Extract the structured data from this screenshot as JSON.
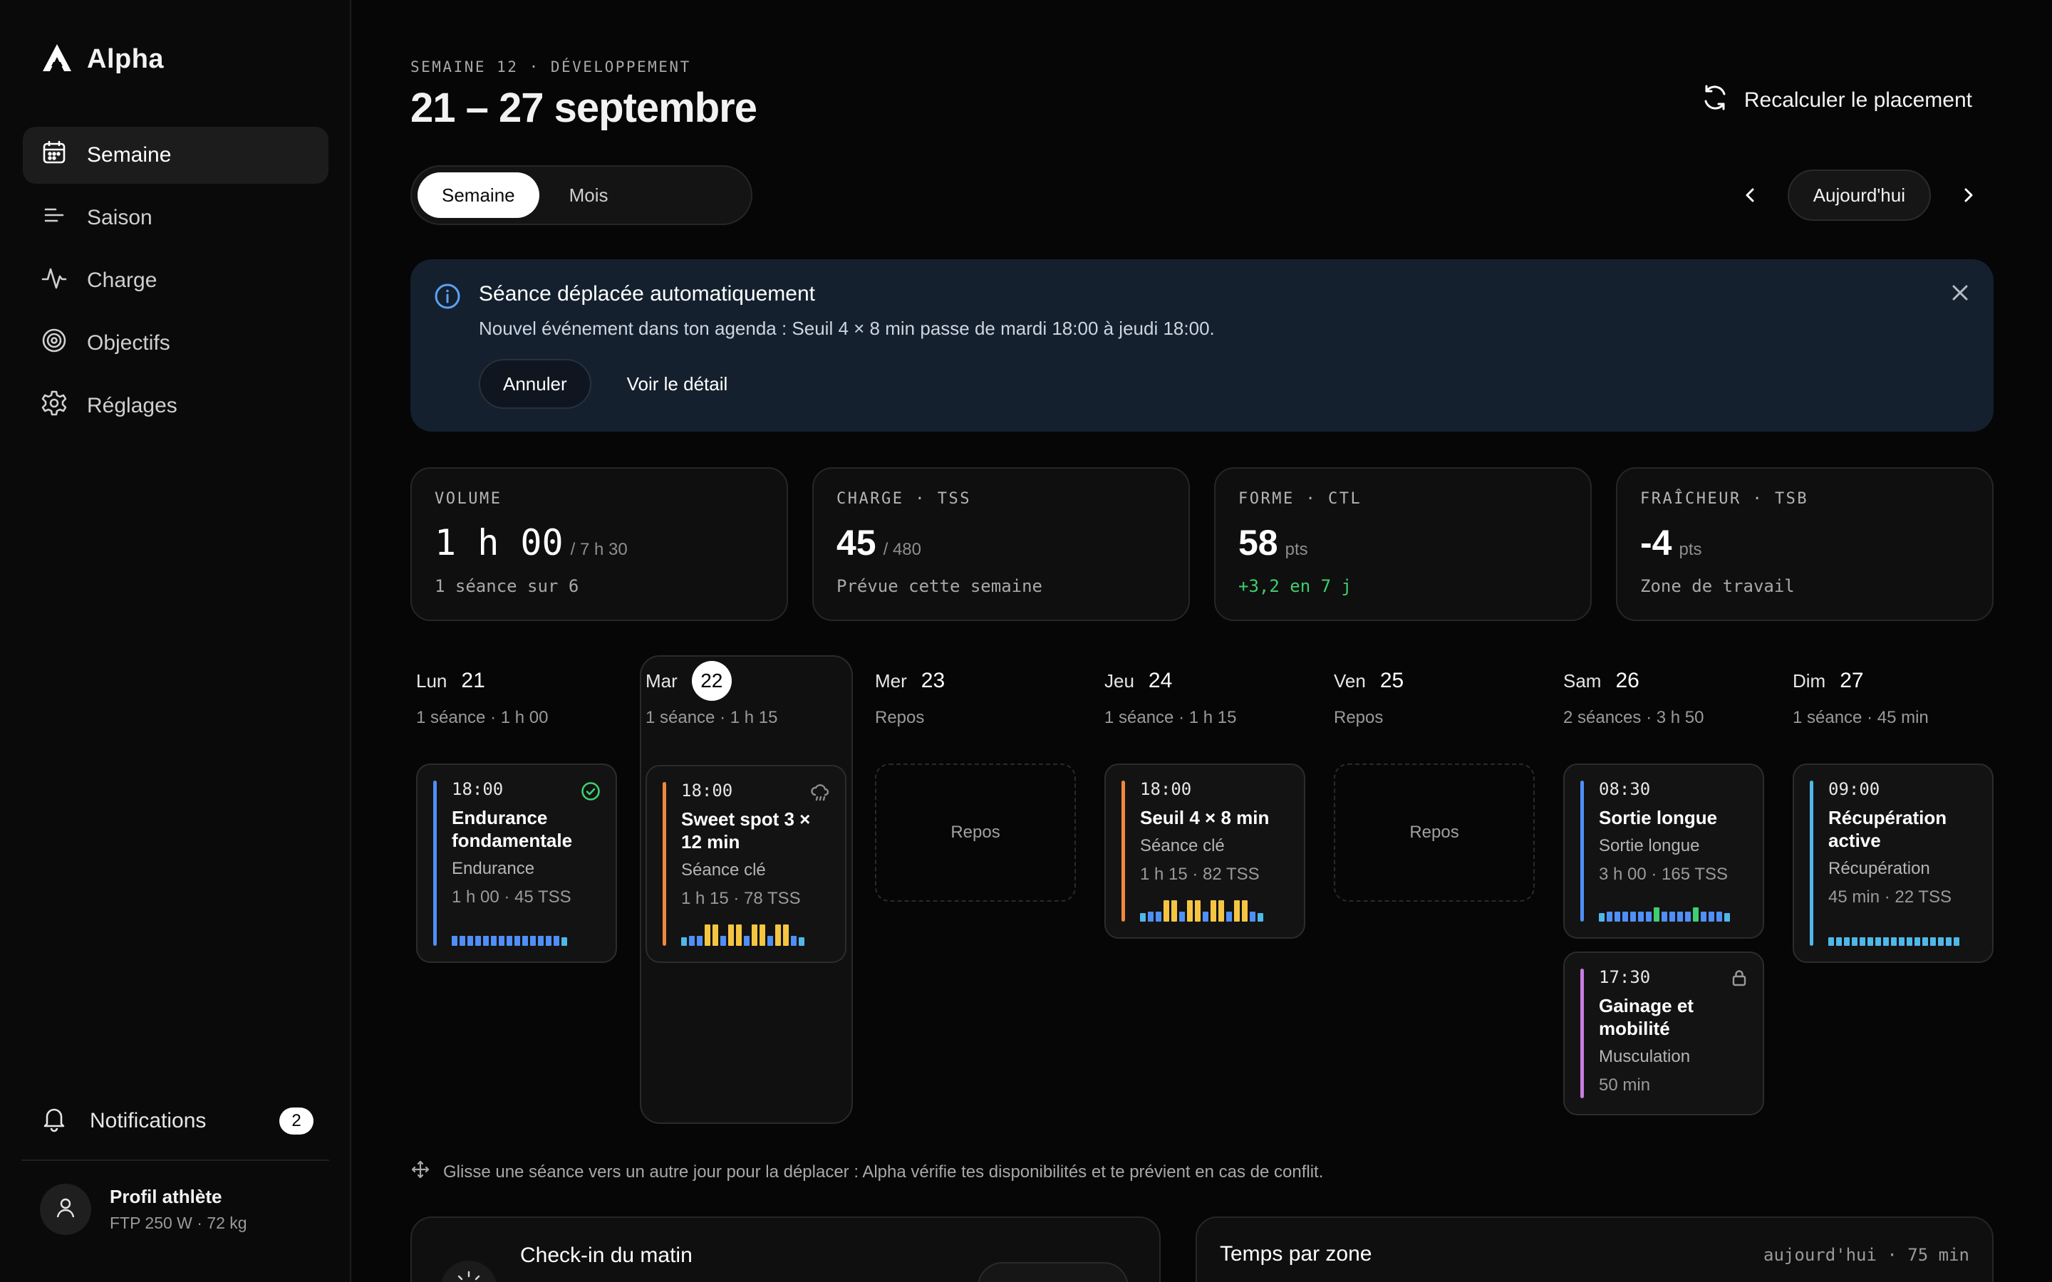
{
  "app": {
    "name": "Alpha"
  },
  "sidebar": {
    "items": [
      {
        "label": "Semaine",
        "icon": "calendar-icon",
        "active": true
      },
      {
        "label": "Saison",
        "icon": "list-icon",
        "active": false
      },
      {
        "label": "Charge",
        "icon": "pulse-icon",
        "active": false
      },
      {
        "label": "Objectifs",
        "icon": "target-icon",
        "active": false
      },
      {
        "label": "Réglages",
        "icon": "gear-icon",
        "active": false
      }
    ],
    "notifications": {
      "label": "Notifications",
      "count": "2"
    },
    "profile": {
      "name": "Profil athlète",
      "details": "FTP 250 W · 72 kg"
    }
  },
  "header": {
    "eyebrow": "SEMAINE 12 · DÉVELOPPEMENT",
    "title": "21 – 27 septembre",
    "recalc_label": "Recalculer le placement",
    "view_toggle": {
      "week": "Semaine",
      "month": "Mois",
      "selected": "Semaine"
    },
    "today_label": "Aujourd'hui"
  },
  "banner": {
    "title": "Séance déplacée automatiquement",
    "text": "Nouvel événement dans ton agenda : Seuil 4 × 8 min passe de mardi 18:00 à jeudi 18:00.",
    "cancel_label": "Annuler",
    "details_label": "Voir le détail"
  },
  "stats": [
    {
      "label": "VOLUME",
      "value": "1 h 00",
      "suffix": "/ 7 h 30",
      "sub": "1 séance sur 6"
    },
    {
      "label": "CHARGE · TSS",
      "value": "45",
      "suffix": "/ 480",
      "sub": "Prévue cette semaine"
    },
    {
      "label": "FORME · CTL",
      "value": "58",
      "suffix": "pts",
      "sub": "+3,2 en 7 j"
    },
    {
      "label": "FRAÎCHEUR · TSB",
      "value": "-4",
      "suffix": "pts",
      "sub": "Zone de travail"
    }
  ],
  "week": {
    "days": [
      {
        "name": "Lun",
        "num": "21",
        "summary": "1 séance · 1 h 00"
      },
      {
        "name": "Mar",
        "num": "22",
        "summary": "1 séance · 1 h 15",
        "today": true
      },
      {
        "name": "Mer",
        "num": "23",
        "summary": "Repos",
        "rest_label": "Repos"
      },
      {
        "name": "Jeu",
        "num": "24",
        "summary": "1 séance · 1 h 15"
      },
      {
        "name": "Ven",
        "num": "25",
        "summary": "Repos",
        "rest_label": "Repos"
      },
      {
        "name": "Sam",
        "num": "26",
        "summary": "2 séances · 3 h 50"
      },
      {
        "name": "Dim",
        "num": "27",
        "summary": "1 séance · 45 min"
      }
    ],
    "sessions": {
      "lun": {
        "time": "18:00",
        "title": "Endurance fondamentale",
        "type": "Endurance",
        "meta": "1 h 00 · 45 TSS",
        "status": "done",
        "color": "#4f8ff7"
      },
      "mar": {
        "time": "18:00",
        "title": "Sweet spot 3 × 12 min",
        "type": "Séance clé",
        "meta": "1 h 15 · 78 TSS",
        "status": "weather",
        "color": "#f0883e"
      },
      "jeu": {
        "time": "18:00",
        "title": "Seuil 4 × 8 min",
        "type": "Séance clé",
        "meta": "1 h 15 · 82 TSS",
        "color": "#f0883e"
      },
      "sam1": {
        "time": "08:30",
        "title": "Sortie longue",
        "type": "Sortie longue",
        "meta": "3 h 00 · 165 TSS",
        "color": "#4f8ff7"
      },
      "sam2": {
        "time": "17:30",
        "title": "Gainage et mobilité",
        "type": "Musculation",
        "meta": "50 min",
        "status": "locked",
        "color": "#c77dde"
      },
      "dim": {
        "time": "09:00",
        "title": "Récupération active",
        "type": "Récupération",
        "meta": "45 min · 22 TSS",
        "color": "#4fb8e8"
      }
    },
    "zone_colors": {
      "z1": "#4fb8e8",
      "z2": "#4f8ff7",
      "z3": "#3ecf6e",
      "z4": "#f5c542"
    }
  },
  "hint": "Glisse une séance vers un autre jour pour la déplacer : Alpha vérifie tes disponibilités et te prévient en cas de conflit.",
  "panels": {
    "checkin": {
      "title": "Check-in du matin"
    },
    "zones": {
      "title": "Temps par zone",
      "meta": "aujourd'hui · 75 min"
    }
  }
}
